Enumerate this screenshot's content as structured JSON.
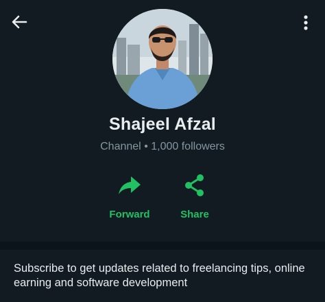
{
  "channel": {
    "name": "Shajeel Afzal",
    "type_label": "Channel",
    "separator": "•",
    "followers": "1,000 followers"
  },
  "actions": {
    "forward_label": "Forward",
    "share_label": "Share"
  },
  "description": "Subscribe to get updates related to freelancing tips, online earning and software development",
  "icons": {
    "back": "arrow-left-icon",
    "menu": "more-vertical-icon",
    "forward": "forward-arrow-icon",
    "share": "share-icon"
  },
  "colors": {
    "background": "#111b21",
    "accent": "#21c063",
    "primary_text": "#e9edef",
    "secondary_text": "#8696a0",
    "divider": "#0b141a"
  }
}
